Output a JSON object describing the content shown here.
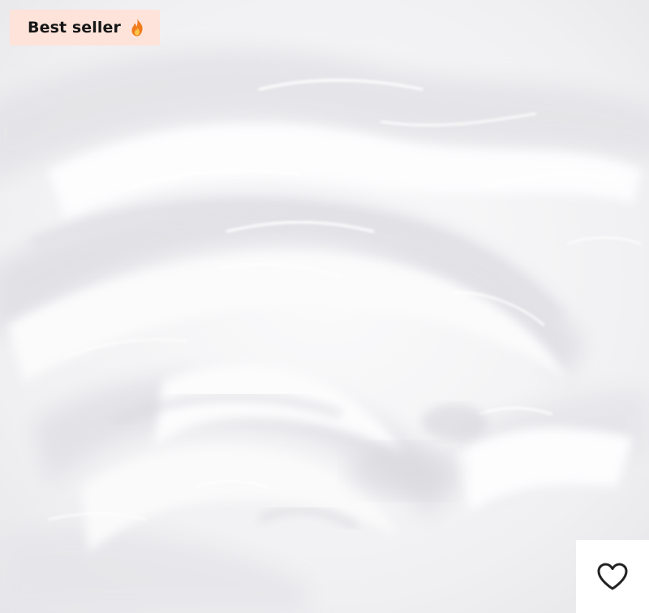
{
  "product": {
    "image_description_icon": "cream-texture-image",
    "badge": {
      "label": "Best seller",
      "icon": "fire-icon",
      "background": "#fde3da",
      "text_color": "#161616"
    },
    "wishlist": {
      "icon": "heart-outline-icon",
      "background": "#ffffff",
      "icon_color": "#222222"
    }
  }
}
